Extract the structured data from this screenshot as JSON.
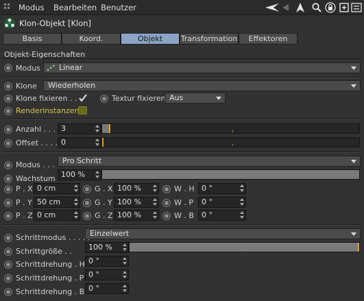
{
  "menubar": {
    "items": [
      "Modus",
      "Bearbeiten",
      "Benutzer"
    ],
    "icons": [
      "back-arrow-icon",
      "up-arrow-icon",
      "search-icon",
      "lock-icon",
      "new-panel-icon",
      "menu-icon"
    ]
  },
  "header": {
    "title": "Klon-Objekt [Klon]"
  },
  "tabs": [
    "Basis",
    "Koord.",
    "Objekt",
    "Transformation",
    "Effektoren"
  ],
  "active_tab": "Objekt",
  "section": {
    "title": "Objekt-Eigenschaften"
  },
  "modus": {
    "label": "Modus",
    "value": "Linear"
  },
  "klone": {
    "label": "Klone",
    "value": "Wiederholen"
  },
  "klone_fixieren": {
    "label": "Klone fixieren . .",
    "checked": true
  },
  "textur_fixieren": {
    "label": "Textur fixieren",
    "value": "Aus"
  },
  "renderinstanzen": {
    "label": "Renderinstanzen",
    "checked": false
  },
  "anzahl": {
    "label": "Anzahl . . .",
    "value": "3"
  },
  "offset": {
    "label": "Offset . . . .",
    "value": "0"
  },
  "modus2": {
    "label": "Modus . . .",
    "value": "Pro Schritt"
  },
  "wachstum": {
    "label": "Wachstum",
    "value": "100 %",
    "level_percent": 100
  },
  "position": {
    "labels": [
      "P . X",
      "P . Y",
      "P . Z"
    ],
    "values": [
      "0 cm",
      "50 cm",
      "0 cm"
    ]
  },
  "scale": {
    "labels": [
      "G . X",
      "G . Y",
      "G . Z"
    ],
    "values": [
      "100 %",
      "100 %",
      "100 %"
    ]
  },
  "rotation": {
    "labels": [
      "W . H",
      "W . P",
      "W . B"
    ],
    "values": [
      "0 °",
      "0 °",
      "0 °"
    ]
  },
  "schrittmodus": {
    "label": "Schrittmodus . . . . .",
    "value": "Einzelwert"
  },
  "schrittgroesse": {
    "label": "Schrittgröße . .",
    "value": "100 %",
    "level_percent": 100
  },
  "schrittdrehung": {
    "labels": [
      "Schrittdrehung . H",
      "Schrittdrehung . P",
      "Schrittdrehung . B"
    ],
    "values": [
      "0 °",
      "0 °",
      "0 °"
    ]
  },
  "colors": {
    "active_tab": "#8aa4c8",
    "slider_handle": "#e8a020",
    "highlight_label": "#d8c44a"
  }
}
